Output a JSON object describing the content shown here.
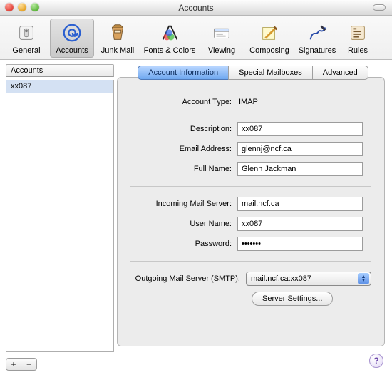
{
  "window": {
    "title": "Accounts"
  },
  "toolbar": {
    "items": [
      {
        "label": "General"
      },
      {
        "label": "Accounts"
      },
      {
        "label": "Junk Mail"
      },
      {
        "label": "Fonts & Colors"
      },
      {
        "label": "Viewing"
      },
      {
        "label": "Composing"
      },
      {
        "label": "Signatures"
      },
      {
        "label": "Rules"
      }
    ]
  },
  "sidebar": {
    "header": "Accounts",
    "items": [
      {
        "label": "xx087"
      }
    ],
    "add": "+",
    "remove": "−"
  },
  "tabs": {
    "items": [
      {
        "label": "Account Information"
      },
      {
        "label": "Special Mailboxes"
      },
      {
        "label": "Advanced"
      }
    ]
  },
  "form": {
    "account_type_label": "Account Type:",
    "account_type_value": "IMAP",
    "description_label": "Description:",
    "description_value": "xx087",
    "email_label": "Email Address:",
    "email_value": "glennj@ncf.ca",
    "fullname_label": "Full Name:",
    "fullname_value": "Glenn Jackman",
    "incoming_label": "Incoming Mail Server:",
    "incoming_value": "mail.ncf.ca",
    "username_label": "User Name:",
    "username_value": "xx087",
    "password_label": "Password:",
    "password_value": "•••••••",
    "smtp_label": "Outgoing Mail Server (SMTP):",
    "smtp_value": "mail.ncf.ca:xx087",
    "server_settings_btn": "Server Settings...",
    "help": "?"
  }
}
